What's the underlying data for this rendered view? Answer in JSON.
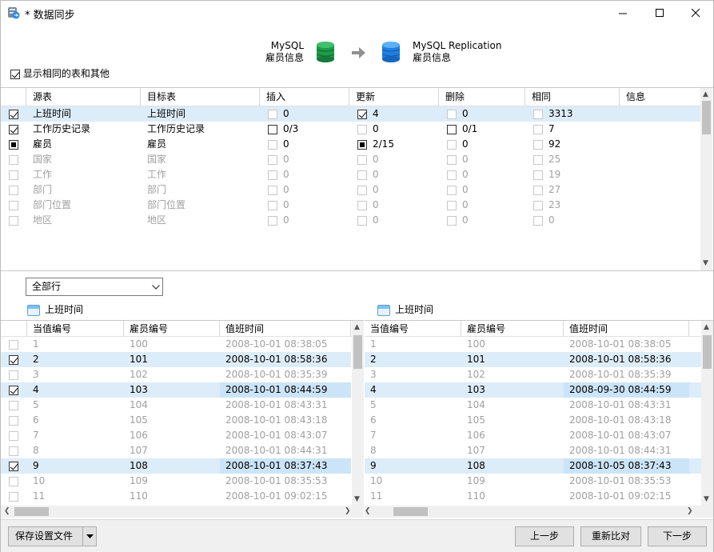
{
  "window": {
    "title": "* 数据同步",
    "app_icon": "sync-app-icon"
  },
  "header": {
    "source_db": "MySQL",
    "source_schema": "雇员信息",
    "target_db": "MySQL Replication",
    "target_schema": "雇员信息",
    "source_color": "#1e9a4a",
    "target_color": "#1f7fe0"
  },
  "show_same_label": "显示相同的表和其他",
  "show_same_checked": true,
  "table_headers": [
    "源表",
    "目标表",
    "插入",
    "更新",
    "删除",
    "相同",
    "信息"
  ],
  "table_rows": [
    {
      "state": "checked",
      "enabled": true,
      "selected": true,
      "src": "上班时间",
      "dst": "上班时间",
      "ins_cb": "off",
      "ins": "0",
      "upd_cb": "checked",
      "upd": "4",
      "del_cb": "off",
      "del": "0",
      "same": "3313"
    },
    {
      "state": "checked",
      "enabled": true,
      "selected": false,
      "src": "工作历史记录",
      "dst": "工作历史记录",
      "ins_cb": "empty",
      "ins": "0/3",
      "upd_cb": "none",
      "upd": "0",
      "del_cb": "empty",
      "del": "0/1",
      "same": "7"
    },
    {
      "state": "indeterminate",
      "enabled": true,
      "selected": false,
      "src": "雇员",
      "dst": "雇员",
      "ins_cb": "off",
      "ins": "0",
      "upd_cb": "indeterminate",
      "upd": "2/15",
      "del_cb": "none",
      "del": "0",
      "same": "92"
    },
    {
      "state": "off",
      "enabled": false,
      "selected": false,
      "src": "国家",
      "dst": "国家",
      "ins_cb": "off",
      "ins": "0",
      "upd_cb": "none",
      "upd": "0",
      "del_cb": "none",
      "del": "0",
      "same": "25"
    },
    {
      "state": "off",
      "enabled": false,
      "selected": false,
      "src": "工作",
      "dst": "工作",
      "ins_cb": "off",
      "ins": "0",
      "upd_cb": "none",
      "upd": "0",
      "del_cb": "none",
      "del": "0",
      "same": "19"
    },
    {
      "state": "off",
      "enabled": false,
      "selected": false,
      "src": "部门",
      "dst": "部门",
      "ins_cb": "off",
      "ins": "0",
      "upd_cb": "none",
      "upd": "0",
      "del_cb": "none",
      "del": "0",
      "same": "27"
    },
    {
      "state": "off",
      "enabled": false,
      "selected": false,
      "src": "部门位置",
      "dst": "部门位置",
      "ins_cb": "off",
      "ins": "0",
      "upd_cb": "none",
      "upd": "0",
      "del_cb": "none",
      "del": "0",
      "same": "23"
    },
    {
      "state": "off",
      "enabled": false,
      "selected": false,
      "src": "地区",
      "dst": "地区",
      "ins_cb": "off",
      "ins": "0",
      "upd_cb": "none",
      "upd": "0",
      "del_cb": "none",
      "del": "0",
      "same": "0"
    }
  ],
  "filter": {
    "value": "全部行"
  },
  "left_panel": {
    "title": "上班时间",
    "headers": [
      "当值编号",
      "雇员编号",
      "值班时间"
    ],
    "rows": [
      {
        "checked": false,
        "diff": false,
        "c1": "1",
        "c2": "100",
        "c3": "2008-10-01 08:38:05"
      },
      {
        "checked": true,
        "diff": true,
        "c1": "2",
        "c2": "101",
        "c3": "2008-10-01 08:58:36"
      },
      {
        "checked": false,
        "diff": false,
        "c1": "3",
        "c2": "102",
        "c3": "2008-10-01 08:35:39"
      },
      {
        "checked": true,
        "diff": true,
        "c1": "4",
        "c2": "103",
        "c3": "2008-10-01 08:44:59"
      },
      {
        "checked": false,
        "diff": false,
        "c1": "5",
        "c2": "104",
        "c3": "2008-10-01 08:43:31"
      },
      {
        "checked": false,
        "diff": false,
        "c1": "6",
        "c2": "105",
        "c3": "2008-10-01 08:43:18"
      },
      {
        "checked": false,
        "diff": false,
        "c1": "7",
        "c2": "106",
        "c3": "2008-10-01 08:43:07"
      },
      {
        "checked": false,
        "diff": false,
        "c1": "8",
        "c2": "107",
        "c3": "2008-10-01 08:44:31"
      },
      {
        "checked": true,
        "diff": true,
        "c1": "9",
        "c2": "108",
        "c3": "2008-10-01 08:37:43"
      },
      {
        "checked": false,
        "diff": false,
        "c1": "10",
        "c2": "109",
        "c3": "2008-10-01 08:35:53"
      },
      {
        "checked": false,
        "diff": false,
        "c1": "11",
        "c2": "110",
        "c3": "2008-10-01 09:02:15"
      }
    ]
  },
  "right_panel": {
    "title": "上班时间",
    "headers": [
      "当值编号",
      "雇员编号",
      "值班时间"
    ],
    "rows": [
      {
        "diff": false,
        "c1": "1",
        "c2": "100",
        "c3": "2008-10-01 08:38:05"
      },
      {
        "diff": true,
        "c1": "2",
        "c2": "101",
        "c3": "2008-10-01 08:58:36"
      },
      {
        "diff": false,
        "c1": "3",
        "c2": "102",
        "c3": "2008-10-01 08:35:39"
      },
      {
        "diff": true,
        "c1": "4",
        "c2": "103",
        "c3": "2008-09-30 08:44:59",
        "hl": true
      },
      {
        "diff": false,
        "c1": "5",
        "c2": "104",
        "c3": "2008-10-01 08:43:31"
      },
      {
        "diff": false,
        "c1": "6",
        "c2": "105",
        "c3": "2008-10-01 08:43:18"
      },
      {
        "diff": false,
        "c1": "7",
        "c2": "106",
        "c3": "2008-10-01 08:43:07"
      },
      {
        "diff": false,
        "c1": "8",
        "c2": "107",
        "c3": "2008-10-01 08:44:31"
      },
      {
        "diff": true,
        "c1": "9",
        "c2": "108",
        "c3": "2008-10-05 08:37:43",
        "hl": true
      },
      {
        "diff": false,
        "c1": "10",
        "c2": "109",
        "c3": "2008-10-01 08:35:53"
      },
      {
        "diff": false,
        "c1": "11",
        "c2": "110",
        "c3": "2008-10-01 09:02:15"
      }
    ]
  },
  "footer": {
    "save_label": "保存设置文件",
    "prev_label": "上一步",
    "recompare_label": "重新比对",
    "next_label": "下一步"
  },
  "colors": {
    "selected_row": "#ddecf9",
    "diff_highlight": "#cce4f7"
  }
}
